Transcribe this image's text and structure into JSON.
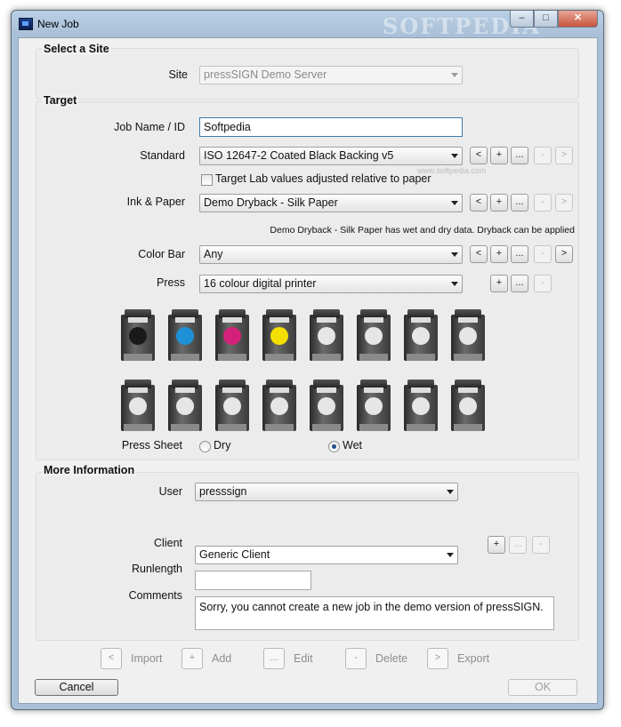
{
  "window": {
    "title": "New Job",
    "watermark": "SOFTPEDIA",
    "controls": {
      "minimize": "–",
      "maximize": "□",
      "close": "✕"
    }
  },
  "site_section": {
    "header": "Select a Site",
    "site_label": "Site",
    "site_value": "pressSIGN Demo Server"
  },
  "target_section": {
    "header": "Target",
    "job_name_label": "Job Name / ID",
    "job_name_value": "Softpedia",
    "standard_label": "Standard",
    "standard_value": "ISO 12647-2 Coated Black Backing v5",
    "target_lab_label": "Target Lab values adjusted relative to paper",
    "target_lab_checked": false,
    "ink_paper_label": "Ink & Paper",
    "ink_paper_value": "Demo Dryback - Silk Paper",
    "ink_note": "Demo Dryback - Silk Paper has wet and dry data. Dryback can be applied",
    "color_bar_label": "Color Bar",
    "color_bar_value": "Any",
    "press_label": "Press",
    "press_value": "16 colour digital printer",
    "press_sheet_label": "Press Sheet",
    "press_sheet_options": [
      "Dry",
      "Wet"
    ],
    "press_sheet_selected": "Wet",
    "small_buttons": {
      "prev": "<",
      "add": "+",
      "more": "...",
      "remove": "-",
      "next": ">"
    }
  },
  "cartridges": {
    "row1": [
      "#1a1a1a",
      "#1e90d6",
      "#d4217a",
      "#f3e000",
      "#e6e6e6",
      "#e6e6e6",
      "#e6e6e6",
      "#e6e6e6"
    ],
    "row2": [
      "#e6e6e6",
      "#e6e6e6",
      "#e6e6e6",
      "#e6e6e6",
      "#e6e6e6",
      "#e6e6e6",
      "#e6e6e6",
      "#e6e6e6"
    ]
  },
  "more_info_section": {
    "header": "More Information",
    "user_label": "User",
    "user_value": "presssign",
    "client_label": "Client",
    "client_value": "Generic Client",
    "runlength_label": "Runlength",
    "runlength_value": "",
    "comments_label": "Comments",
    "comments_value": "Sorry, you cannot create a new job in the demo version of pressSIGN."
  },
  "bottom_toolbar": {
    "import": {
      "icon": "<",
      "label": "Import"
    },
    "add": {
      "icon": "+",
      "label": "Add"
    },
    "edit": {
      "icon": "...",
      "label": "Edit"
    },
    "delete": {
      "icon": "-",
      "label": "Delete"
    },
    "export": {
      "icon": ">",
      "label": "Export"
    }
  },
  "footer": {
    "cancel": "Cancel",
    "ok": "OK"
  },
  "watermark_small": "www.softpedia.com"
}
